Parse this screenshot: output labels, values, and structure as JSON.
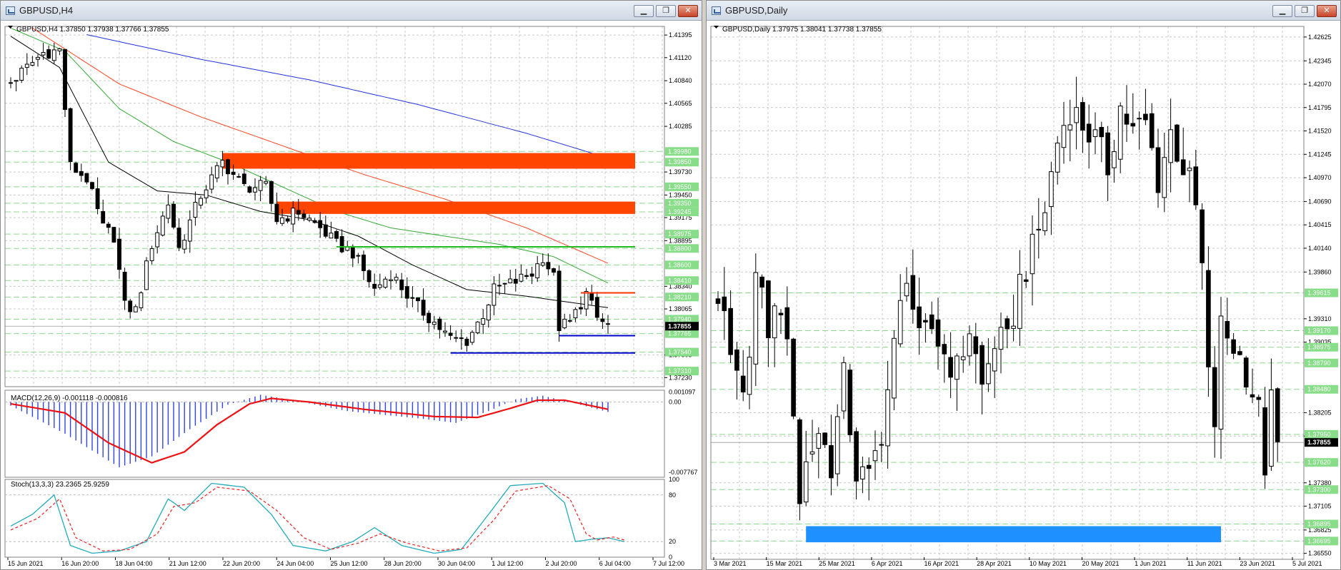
{
  "left_window": {
    "title": "GBPUSD,H4",
    "info": "GBPUSD,H4  1.37850 1.37938 1.37766 1.37855",
    "macd_label": "MACD(12,26,9) -0.001118 -0.000816",
    "stoch_label": "Stoch(13,3,3) 23.2365 25.9259",
    "buttons": {
      "minimize": "▁",
      "maximize": "❐",
      "close": "✕"
    }
  },
  "right_window": {
    "title": "GBPUSD,Daily",
    "info": "GBPUSD,Daily  1.37975 1.38041 1.37738 1.37855",
    "buttons": {
      "minimize": "▁",
      "maximize": "❐",
      "close": "✕"
    }
  },
  "colors": {
    "bull": "#ffffff",
    "bear": "#000000",
    "grid": "#c8c8c8",
    "supply_zone": "#ff4500",
    "demand_zone": "#1e90ff",
    "support_line": "#0000cc",
    "resistance_line": "#ff3300",
    "level_green": "#22bb22",
    "ma_fast": "#000000",
    "ma_green": "#33aa33",
    "ma_red": "#ff4422",
    "ma_blue": "#2233dd",
    "price_tag": "#000000",
    "level_tag": "#88dd88"
  },
  "chart_data": [
    {
      "type": "candlestick",
      "title": "GBPUSD,H4",
      "x_labels": [
        "15 Jun 2021",
        "16 Jun 20:00",
        "18 Jun 04:00",
        "21 Jun 12:00",
        "22 Jun 20:00",
        "24 Jun 04:00",
        "25 Jun 12:00",
        "28 Jun 20:00",
        "30 Jun 04:00",
        "1 Jul 12:00",
        "2 Jul 20:00",
        "6 Jul 04:00",
        "7 Jul 12:00"
      ],
      "y_ticks": [
        "1.41395",
        "1.41120",
        "1.40840",
        "1.40565",
        "1.40285",
        "1.39730",
        "1.39450",
        "1.39175",
        "1.38895",
        "1.38340",
        "1.38065",
        "1.37505",
        "1.37230"
      ],
      "level_tags": [
        "1.39980",
        "1.39850",
        "1.39550",
        "1.39350",
        "1.39245",
        "1.38975",
        "1.38800",
        "1.38600",
        "1.38410",
        "1.38210",
        "1.37940",
        "1.37765",
        "1.37540",
        "1.37310"
      ],
      "current_price": "1.37855",
      "ylim": [
        1.3712,
        1.415
      ],
      "zones": [
        {
          "type": "supply",
          "low": 1.3977,
          "high": 1.3996,
          "from": 39,
          "to": 115
        },
        {
          "type": "supply",
          "low": 1.3922,
          "high": 1.3937,
          "from": 49,
          "to": 115
        }
      ],
      "lines": [
        {
          "kind": "level_green",
          "y": 1.3882,
          "from": 60,
          "to": 115
        },
        {
          "kind": "resistance",
          "y": 1.3826,
          "from": 105,
          "to": 115
        },
        {
          "kind": "support",
          "y": 1.3774,
          "from": 101,
          "to": 115
        },
        {
          "kind": "support",
          "y": 1.3753,
          "from": 81,
          "to": 115
        }
      ],
      "anchors": [
        [
          0,
          1.4082
        ],
        [
          6,
          1.4118
        ],
        [
          9,
          1.4121
        ],
        [
          11,
          1.398
        ],
        [
          14,
          1.3965
        ],
        [
          17,
          1.3905
        ],
        [
          19,
          1.3895
        ],
        [
          21,
          1.381
        ],
        [
          23,
          1.3805
        ],
        [
          26,
          1.3885
        ],
        [
          29,
          1.3935
        ],
        [
          31,
          1.388
        ],
        [
          35,
          1.3945
        ],
        [
          39,
          1.3985
        ],
        [
          43,
          1.3955
        ],
        [
          47,
          1.3955
        ],
        [
          49,
          1.3915
        ],
        [
          53,
          1.3925
        ],
        [
          57,
          1.3905
        ],
        [
          60,
          1.3885
        ],
        [
          63,
          1.3875
        ],
        [
          67,
          1.383
        ],
        [
          70,
          1.385
        ],
        [
          74,
          1.3815
        ],
        [
          78,
          1.379
        ],
        [
          81,
          1.377
        ],
        [
          84,
          1.3768
        ],
        [
          87,
          1.38
        ],
        [
          89,
          1.383
        ],
        [
          93,
          1.384
        ],
        [
          96,
          1.385
        ],
        [
          98,
          1.387
        ],
        [
          100,
          1.3845
        ],
        [
          101,
          1.3785
        ],
        [
          103,
          1.379
        ],
        [
          106,
          1.3825
        ],
        [
          108,
          1.3795
        ],
        [
          110,
          1.3786
        ]
      ],
      "ma_fast_anchors": [
        [
          0,
          1.4138
        ],
        [
          9,
          1.41
        ],
        [
          18,
          1.3985
        ],
        [
          27,
          1.395
        ],
        [
          36,
          1.3945
        ],
        [
          46,
          1.3925
        ],
        [
          55,
          1.3915
        ],
        [
          64,
          1.3895
        ],
        [
          74,
          1.386
        ],
        [
          84,
          1.383
        ],
        [
          95,
          1.3822
        ],
        [
          110,
          1.3808
        ]
      ],
      "ma_green_anchors": [
        [
          0,
          1.4148
        ],
        [
          10,
          1.412
        ],
        [
          20,
          1.405
        ],
        [
          30,
          1.401
        ],
        [
          40,
          1.3985
        ],
        [
          50,
          1.3955
        ],
        [
          60,
          1.3925
        ],
        [
          70,
          1.3905
        ],
        [
          80,
          1.3895
        ],
        [
          90,
          1.3885
        ],
        [
          100,
          1.387
        ],
        [
          110,
          1.3838
        ]
      ],
      "ma_red_anchors": [
        [
          4,
          1.4148
        ],
        [
          20,
          1.408
        ],
        [
          35,
          1.404
        ],
        [
          50,
          1.4005
        ],
        [
          65,
          1.397
        ],
        [
          80,
          1.394
        ],
        [
          95,
          1.3905
        ],
        [
          110,
          1.3862
        ]
      ],
      "ma_blue_anchors": [
        [
          14,
          1.414
        ],
        [
          35,
          1.411
        ],
        [
          55,
          1.4085
        ],
        [
          75,
          1.4055
        ],
        [
          95,
          1.402
        ],
        [
          110,
          1.399
        ]
      ],
      "macd": {
        "label": "MACD(12,26,9)",
        "values_label": "-0.001118 -0.000816",
        "y_ticks": [
          "0.001097",
          "0.00",
          "-0.007767"
        ],
        "ylim": [
          -0.0083,
          0.0013
        ],
        "hist_anchors": [
          [
            0,
            -0.0004
          ],
          [
            10,
            -0.0035
          ],
          [
            20,
            -0.0072
          ],
          [
            26,
            -0.006
          ],
          [
            33,
            -0.003
          ],
          [
            40,
            -0.0003
          ],
          [
            46,
            0.0008
          ],
          [
            52,
            0.0002
          ],
          [
            62,
            -0.001
          ],
          [
            75,
            -0.0018
          ],
          [
            82,
            -0.0023
          ],
          [
            88,
            -0.001
          ],
          [
            93,
            0.0003
          ],
          [
            98,
            0.0007
          ],
          [
            103,
            0.0
          ],
          [
            110,
            -0.0011
          ]
        ],
        "signal_anchors": [
          [
            0,
            -0.0002
          ],
          [
            10,
            -0.0012
          ],
          [
            18,
            -0.0045
          ],
          [
            26,
            -0.0067
          ],
          [
            32,
            -0.0055
          ],
          [
            38,
            -0.0025
          ],
          [
            44,
            -0.0002
          ],
          [
            48,
            0.0004
          ],
          [
            55,
            0.0
          ],
          [
            65,
            -0.0008
          ],
          [
            78,
            -0.0016
          ],
          [
            86,
            -0.0017
          ],
          [
            92,
            -0.0007
          ],
          [
            97,
            0.0002
          ],
          [
            102,
            0.0002
          ],
          [
            110,
            -0.0008
          ]
        ]
      },
      "stoch": {
        "label": "Stoch(13,3,3)",
        "values_label": "23.2365 25.9259",
        "y_ticks": [
          "100",
          "80",
          "20",
          "0"
        ],
        "ylim": [
          0,
          100
        ],
        "main_anchors": [
          [
            0,
            40
          ],
          [
            4,
            55
          ],
          [
            8,
            80
          ],
          [
            11,
            15
          ],
          [
            15,
            5
          ],
          [
            20,
            8
          ],
          [
            25,
            20
          ],
          [
            29,
            75
          ],
          [
            32,
            60
          ],
          [
            37,
            95
          ],
          [
            43,
            90
          ],
          [
            48,
            55
          ],
          [
            52,
            15
          ],
          [
            58,
            8
          ],
          [
            63,
            20
          ],
          [
            67,
            38
          ],
          [
            72,
            15
          ],
          [
            78,
            5
          ],
          [
            83,
            10
          ],
          [
            88,
            55
          ],
          [
            92,
            92
          ],
          [
            98,
            95
          ],
          [
            102,
            70
          ],
          [
            104,
            20
          ],
          [
            107,
            23
          ],
          [
            110,
            25
          ],
          [
            113,
            20
          ]
        ],
        "signal_anchors": [
          [
            0,
            35
          ],
          [
            5,
            50
          ],
          [
            9,
            75
          ],
          [
            12,
            25
          ],
          [
            17,
            8
          ],
          [
            22,
            10
          ],
          [
            27,
            30
          ],
          [
            30,
            65
          ],
          [
            34,
            70
          ],
          [
            38,
            90
          ],
          [
            44,
            85
          ],
          [
            49,
            60
          ],
          [
            54,
            25
          ],
          [
            59,
            10
          ],
          [
            64,
            18
          ],
          [
            68,
            30
          ],
          [
            73,
            18
          ],
          [
            79,
            8
          ],
          [
            84,
            12
          ],
          [
            89,
            48
          ],
          [
            93,
            85
          ],
          [
            99,
            92
          ],
          [
            103,
            75
          ],
          [
            106,
            30
          ],
          [
            108,
            22
          ],
          [
            111,
            26
          ],
          [
            113,
            22
          ]
        ]
      }
    },
    {
      "type": "candlestick",
      "title": "GBPUSD,Daily",
      "x_labels": [
        "3 Mar 2021",
        "15 Mar 2021",
        "25 Mar 2021",
        "6 Apr 2021",
        "16 Apr 2021",
        "28 Apr 2021",
        "10 May 2021",
        "20 May 2021",
        "1 Jun 2021",
        "11 Jun 2021",
        "23 Jun 2021",
        "5 Jul 2021"
      ],
      "y_ticks": [
        "1.42625",
        "1.42345",
        "1.42070",
        "1.41795",
        "1.41520",
        "1.41245",
        "1.40970",
        "1.40690",
        "1.40415",
        "1.40140",
        "1.39860",
        "1.39310",
        "1.39035",
        "1.38205",
        "1.37930",
        "1.37380",
        "1.37105",
        "1.36825",
        "1.36550"
      ],
      "level_tags": [
        "1.39615",
        "1.39170",
        "1.38975",
        "1.38790",
        "1.38480",
        "1.37950",
        "1.37620",
        "1.37300",
        "1.36895",
        "1.36695"
      ],
      "current_price": "1.37855",
      "ylim": [
        1.3648,
        1.4275
      ],
      "zones": [
        {
          "type": "demand",
          "low": 1.3668,
          "high": 1.3687,
          "from": 14,
          "to": 80
        }
      ],
      "lines": [],
      "anchors": [
        [
          0,
          1.396
        ],
        [
          2,
          1.388
        ],
        [
          4,
          1.383
        ],
        [
          6,
          1.398
        ],
        [
          8,
          1.392
        ],
        [
          10,
          1.395
        ],
        [
          12,
          1.383
        ],
        [
          13,
          1.372
        ],
        [
          14,
          1.376
        ],
        [
          16,
          1.38
        ],
        [
          18,
          1.376
        ],
        [
          20,
          1.386
        ],
        [
          22,
          1.375
        ],
        [
          24,
          1.374
        ],
        [
          26,
          1.38
        ],
        [
          30,
          1.399
        ],
        [
          32,
          1.39
        ],
        [
          34,
          1.392
        ],
        [
          36,
          1.389
        ],
        [
          38,
          1.387
        ],
        [
          40,
          1.392
        ],
        [
          42,
          1.385
        ],
        [
          44,
          1.3905
        ],
        [
          46,
          1.39
        ],
        [
          48,
          1.3975
        ],
        [
          50,
          1.401
        ],
        [
          52,
          1.406
        ],
        [
          54,
          1.414
        ],
        [
          56,
          1.418
        ],
        [
          58,
          1.416
        ],
        [
          60,
          1.414
        ],
        [
          62,
          1.411
        ],
        [
          64,
          1.418
        ],
        [
          66,
          1.415
        ],
        [
          68,
          1.416
        ],
        [
          70,
          1.4095
        ],
        [
          72,
          1.415
        ],
        [
          74,
          1.411
        ],
        [
          75,
          1.409
        ],
        [
          76,
          1.406
        ],
        [
          77,
          1.399
        ],
        [
          78,
          1.386
        ],
        [
          79,
          1.381
        ],
        [
          80,
          1.392
        ],
        [
          82,
          1.39
        ],
        [
          84,
          1.387
        ],
        [
          86,
          1.382
        ],
        [
          87,
          1.376
        ],
        [
          88,
          1.383
        ],
        [
          89,
          1.378
        ]
      ]
    }
  ]
}
